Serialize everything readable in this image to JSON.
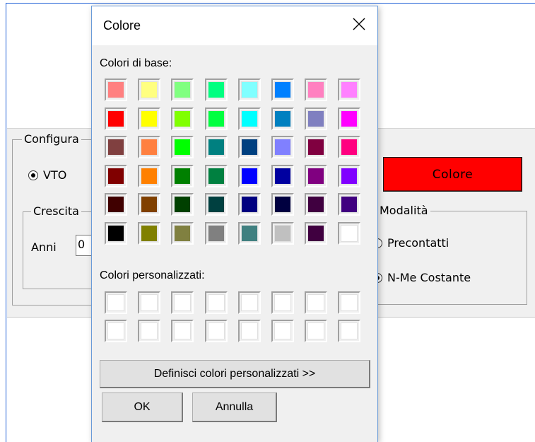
{
  "background_form": {
    "group_config_title": "Configura",
    "radio_vto_label": "VTO",
    "group_growth_title": "Crescita",
    "years_label": "Anni",
    "years_value": "0",
    "color_button_label": "Colore",
    "color_button_bg": "#ff0000",
    "group_mode_title": "Modalità",
    "radio_precontacted_label": "Precontatti",
    "radio_nme_label": "N-Me Costante"
  },
  "dialog": {
    "title": "Colore",
    "base_colors_label": "Colori di base:",
    "custom_colors_label": "Colori personalizzati:",
    "define_custom_button": "Definisci colori personalizzati >>",
    "ok_button": "OK",
    "cancel_button": "Annulla",
    "base_colors": [
      [
        "#ff8080",
        "#ffff80",
        "#80ff80",
        "#00ff80",
        "#80ffff",
        "#0080ff",
        "#ff80c0",
        "#ff80ff"
      ],
      [
        "#ff0000",
        "#ffff00",
        "#80ff00",
        "#00ff40",
        "#00ffff",
        "#0080c0",
        "#8080c0",
        "#ff00ff"
      ],
      [
        "#804040",
        "#ff8040",
        "#00ff00",
        "#008080",
        "#004080",
        "#8080ff",
        "#800040",
        "#ff0080"
      ],
      [
        "#800000",
        "#ff8000",
        "#008000",
        "#008040",
        "#0000ff",
        "#0000a0",
        "#800080",
        "#8000ff"
      ],
      [
        "#400000",
        "#804000",
        "#004000",
        "#004040",
        "#000080",
        "#000040",
        "#400040",
        "#400080"
      ],
      [
        "#000000",
        "#808000",
        "#808040",
        "#808080",
        "#408080",
        "#c0c0c0",
        "#400040",
        "#ffffff"
      ]
    ],
    "custom_colors": [
      [
        "#ffffff",
        "#ffffff",
        "#ffffff",
        "#ffffff",
        "#ffffff",
        "#ffffff",
        "#ffffff",
        "#ffffff"
      ],
      [
        "#ffffff",
        "#ffffff",
        "#ffffff",
        "#ffffff",
        "#ffffff",
        "#ffffff",
        "#ffffff",
        "#ffffff"
      ]
    ]
  }
}
